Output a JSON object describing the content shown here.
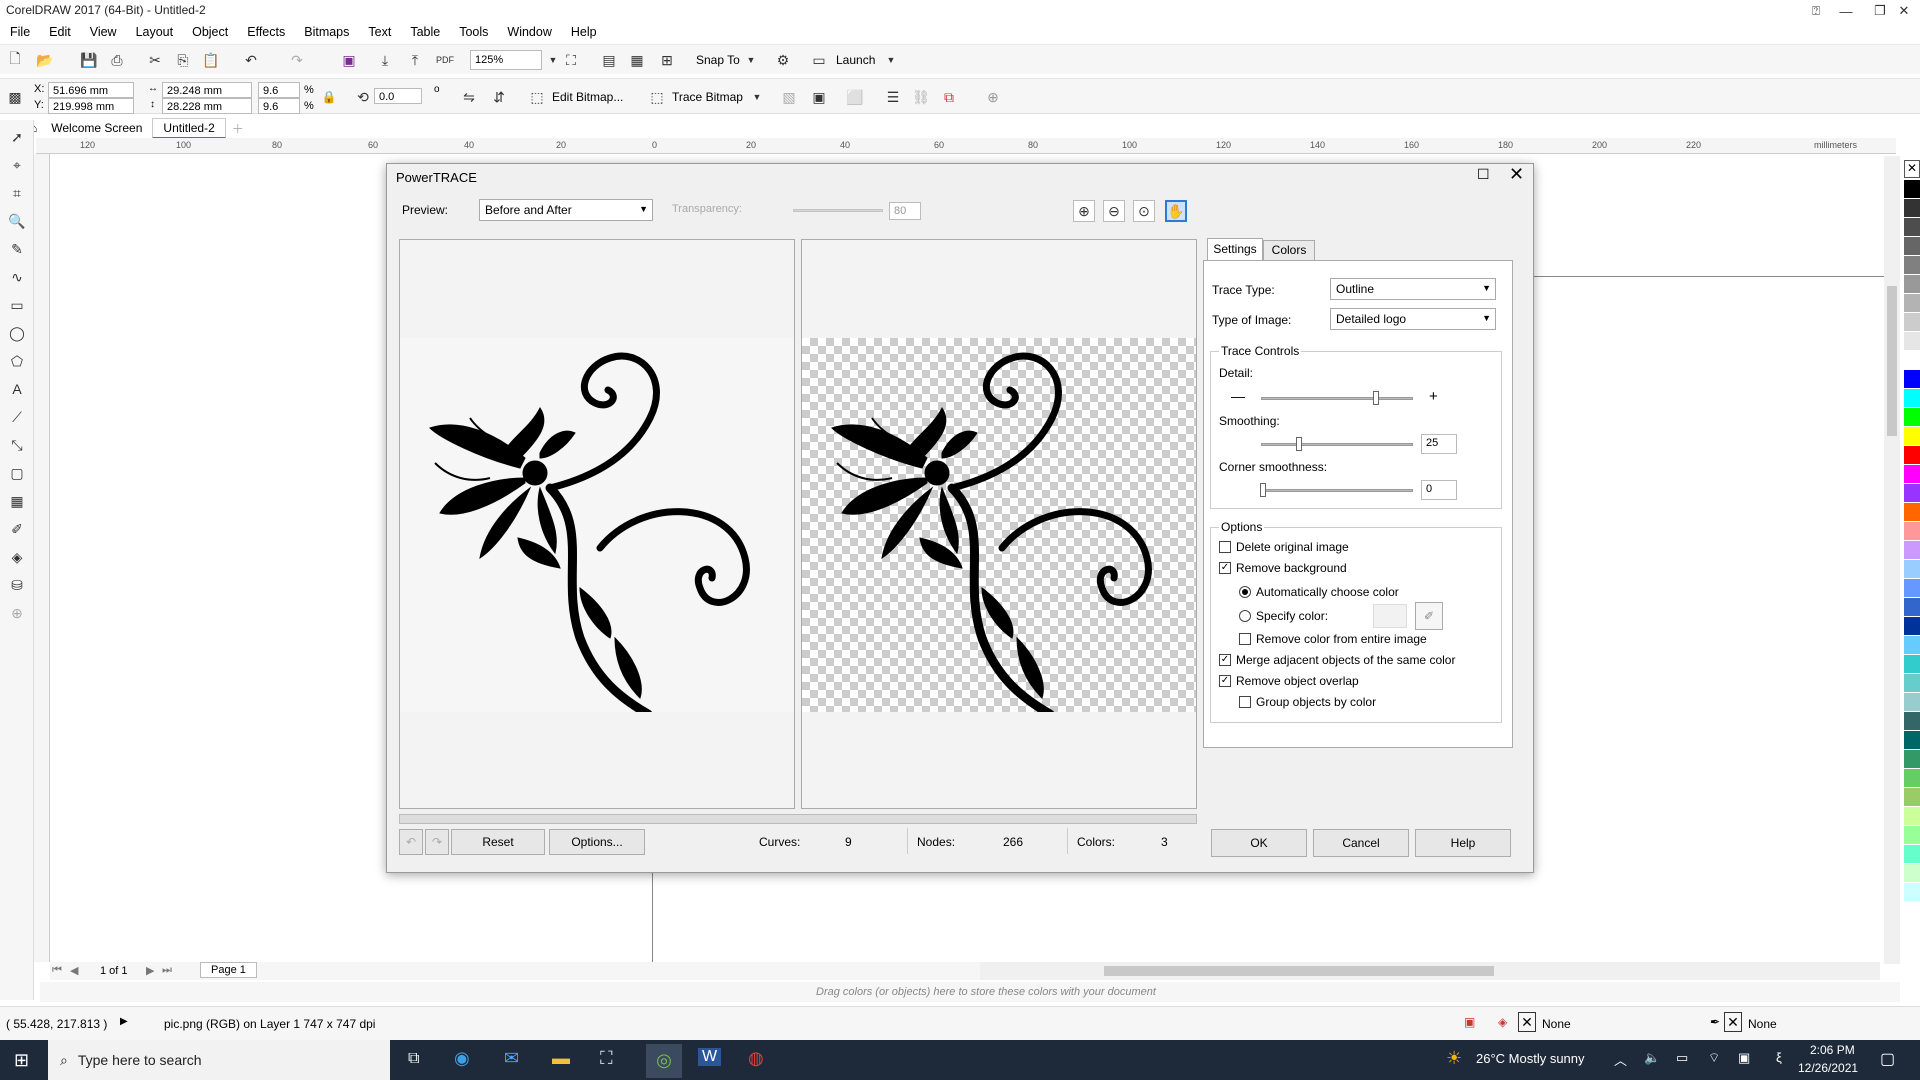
{
  "window": {
    "title": "CorelDRAW 2017 (64-Bit) - Untitled-2"
  },
  "menu": [
    "File",
    "Edit",
    "View",
    "Layout",
    "Object",
    "Effects",
    "Bitmaps",
    "Text",
    "Table",
    "Tools",
    "Window",
    "Help"
  ],
  "toolbar1": {
    "zoom": "125%",
    "snap_to": "Snap To",
    "launch": "Launch"
  },
  "toolbar2": {
    "x": "51.696 mm",
    "y": "219.998 mm",
    "width": "29.248 mm",
    "height": "28.228 mm",
    "scale_w": "9.6",
    "scale_h": "9.6",
    "percent": "%",
    "rotation": "0.0",
    "degree": "o",
    "edit_bitmap": "Edit Bitmap...",
    "trace_bitmap": "Trace Bitmap"
  },
  "doc_tabs": [
    "Welcome Screen",
    "Untitled-2"
  ],
  "ruler": {
    "unit": "millimeters",
    "ticks": [
      "120",
      "100",
      "80",
      "60",
      "40",
      "20",
      "0",
      "20",
      "40",
      "60",
      "80",
      "100",
      "120",
      "140",
      "160",
      "180",
      "200",
      "220"
    ]
  },
  "dialog": {
    "title": "PowerTRACE",
    "preview_label": "Preview:",
    "preview_value": "Before and After",
    "transparency_label": "Transparency:",
    "transparency_value": "80",
    "tabs": [
      "Settings",
      "Colors"
    ],
    "trace_type_label": "Trace Type:",
    "trace_type_value": "Outline",
    "image_type_label": "Type of Image:",
    "image_type_value": "Detailed logo",
    "trace_controls": "Trace Controls",
    "detail_label": "Detail:",
    "detail_level": 0.75,
    "smoothing_label": "Smoothing:",
    "smoothing_value": "25",
    "corner_label": "Corner smoothness:",
    "corner_value": "0",
    "options_label": "Options",
    "opt_delete": "Delete original image",
    "opt_remove_bg": "Remove background",
    "opt_auto_color": "Automatically choose color",
    "opt_specify_color": "Specify color:",
    "opt_remove_entire": "Remove color from entire image",
    "opt_merge": "Merge adjacent objects of the same color",
    "opt_overlap": "Remove object overlap",
    "opt_group": "Group objects by color",
    "reset": "Reset",
    "options_btn": "Options...",
    "curves_label": "Curves:",
    "curves_value": "9",
    "nodes_label": "Nodes:",
    "nodes_value": "266",
    "colors_label": "Colors:",
    "colors_value": "3",
    "ok": "OK",
    "cancel": "Cancel",
    "help": "Help"
  },
  "pagebar": {
    "page_count": "1 of 1",
    "page_tab": "Page 1"
  },
  "colordock_hint": "Drag colors (or objects) here to store these colors with your document",
  "status": {
    "coords": "( 55.428, 217.813 )",
    "info": "pic.png (RGB) on Layer 1 747 x 747 dpi",
    "fill": "None",
    "outline": "None"
  },
  "taskbar": {
    "search_placeholder": "Type here to search",
    "weather": "26°C  Mostly sunny",
    "time": "2:06 PM",
    "date": "12/26/2021"
  },
  "palette_colors": [
    "#000000",
    "#333333",
    "#4d4d4d",
    "#666666",
    "#808080",
    "#999999",
    "#b3b3b3",
    "#cccccc",
    "#e6e6e6",
    "#ffffff",
    "#0000ff",
    "#00ffff",
    "#00ff00",
    "#ffff00",
    "#ff0000",
    "#ff00ff",
    "#9933ff",
    "#ff6600",
    "#ff9999",
    "#cc99ff",
    "#99ccff",
    "#6699ff",
    "#3366cc",
    "#003399",
    "#66ccff",
    "#33cccc",
    "#66cccc",
    "#99cccc",
    "#336666",
    "#006666",
    "#339966",
    "#66cc66",
    "#99cc66",
    "#ccff99",
    "#99ff99",
    "#66ffcc",
    "#ccffcc",
    "#ccffff"
  ]
}
